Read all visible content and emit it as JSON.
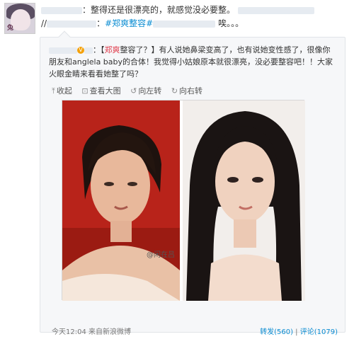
{
  "avatar": {
    "tag_text": "兔"
  },
  "post": {
    "line1_text": "：整得还是很漂亮的，就感觉没必要整。",
    "line2_prefix": "//",
    "hashtag": "#郑爽整容#",
    "line2_suffix": "唉。。。"
  },
  "repost": {
    "text_part1": "：【",
    "highlight": "郑爽",
    "text_part2": "整容了？】有人说她鼻梁变高了，也有说她变性感了，很像你朋友和anglela baby的合体！我觉得小姑娘原本就很漂亮，没必要整容吧！！大家火眼金睛来看看她整了吗？",
    "actions": [
      {
        "icon": "tag-icon",
        "glyph": "⤒",
        "label": "收起"
      },
      {
        "icon": "zoom-icon",
        "glyph": "⊡",
        "label": "查看大图"
      },
      {
        "icon": "rotate-left-icon",
        "glyph": "↺",
        "label": "向左转"
      },
      {
        "icon": "rotate-right-icon",
        "glyph": "↻",
        "label": "向右转"
      }
    ],
    "watermark": "@闲在吕",
    "footer_left": "今天12:04  来自新浪微博",
    "repost_count": "转发(560)",
    "comment_count": "评论(1079)"
  }
}
